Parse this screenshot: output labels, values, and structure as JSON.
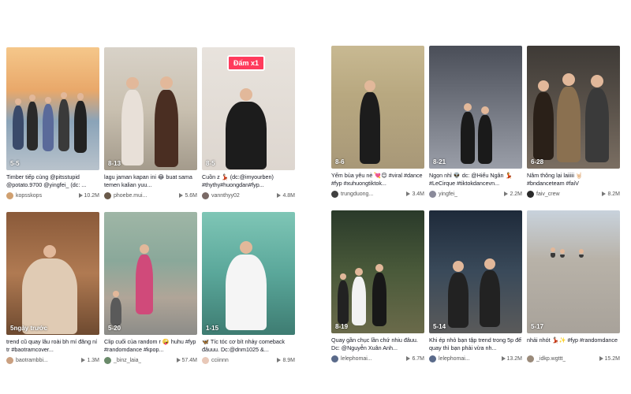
{
  "left_videos": [
    {
      "date": "5-5",
      "caption": "Timber tiếp cùng @pitsstupid @potato.9700 @yingfei_ (dc: ...",
      "author": "kopsskops",
      "views": "10.2M",
      "bg": "linear-gradient(180deg,#f5c78a 0%,#e9a86a 35%,#8aa3b8 60%,#b9c3cc 100%)",
      "avatar_color": "#d0a070"
    },
    {
      "date": "8-13",
      "caption": "lagu jaman kapan ini 😂 buat sama temen kalian yuu...",
      "author": "phoebe.mui...",
      "views": "5.6M",
      "bg": "linear-gradient(180deg,#d8d2c8 0%,#c9c0b0 50%,#a49b8c 100%)",
      "avatar_color": "#6a5a4a"
    },
    {
      "date": "8-5",
      "sticker": "Đấm x1",
      "caption": "Cuồn z 💃🏻 (dc:@imyourben) #thythy#huongdan#fyp...",
      "author": "vannthyy02",
      "views": "4.8M",
      "bg": "linear-gradient(180deg,#e8e3dd 0%,#ddd6cf 100%)",
      "avatar_color": "#7a6a66"
    },
    {
      "date": "5ngày trước",
      "caption": "trend cũ quay lâu roài bh mí đăng ní tr #baotramcover...",
      "author": "baotrambbi...",
      "views": "1.3M",
      "bg": "linear-gradient(180deg,#8a5a3a 0%,#b07a52 50%,#6e4a30 100%)",
      "avatar_color": "#caa080"
    },
    {
      "date": "5-20",
      "caption": "Clip cuối của random r 🤪 huhu #fyp #randomdance #kpop...",
      "author": "_binz_laia_",
      "views": "57.4M",
      "bg": "linear-gradient(180deg,#9fb6a6 0%,#8aa89a 40%,#b0a598 70%,#8c8c88 100%)",
      "avatar_color": "#6a8a6a"
    },
    {
      "date": "1-15",
      "caption": "🦋 Tíc tóc cơ bít nhảy comeback đâuuu. Dc:@dnm1025 &...",
      "author": "cciinnn",
      "views": "8.9M",
      "bg": "linear-gradient(180deg,#7fc6b6 0%,#5aa79a 50%,#3e7c72 100%)",
      "avatar_color": "#e8c8b8"
    }
  ],
  "right_videos": [
    {
      "date": "8-6",
      "caption": "Yếm bùa yêu nè 💘😊 #viral #dance #fyp #xuhuongtiktok...",
      "author": "trungduong...",
      "views": "3.4M",
      "bg": "linear-gradient(180deg,#c8b992 0%,#b8a880 40%,#a89878 100%)",
      "avatar_color": "#404040"
    },
    {
      "date": "8-21",
      "caption": "Ngọn nhỉ 👽 dc: @Hiếu Ngân 💃 #LeCirque #tiktokdancevn...",
      "author": "yingfei_",
      "views": "2.2M",
      "bg": "linear-gradient(180deg,#4a4e58 0%,#6a6e78 40%,#9a9ea8 100%)",
      "avatar_color": "#8a8a9a"
    },
    {
      "date": "6-28",
      "caption": "Nâm thông lại laiiiii 🤘🏻 #bndanceteam #faiV",
      "author": "faiv_crew",
      "views": "8.2M",
      "bg": "linear-gradient(180deg,#3e3a36 0%,#5a524a 50%,#7a6e62 100%)",
      "avatar_color": "#2a2a2a"
    },
    {
      "date": "8-19",
      "caption": "Quay gần chục lần chứ nhiu đâuu. Dc: @Nguyễn Xuân Anh...",
      "author": "lelephomai...",
      "views": "6.7M",
      "bg": "linear-gradient(180deg,#2a3a2a 0%,#4a5a3a 50%,#6a6a4a 100%)",
      "avatar_color": "#5a6a8a"
    },
    {
      "date": "5-14",
      "caption": "Khi ép nhỏ bạn tập trend trong 5p để quay thì bạn phải vừa nh...",
      "author": "lelephomai...",
      "views": "13.2M",
      "bg": "linear-gradient(180deg,#1e2a3a 0%,#3a4a5a 50%,#5a5a5a 100%)",
      "avatar_color": "#5a6a8a"
    },
    {
      "date": "5-17",
      "caption": "nhải nhót 💃🏻✨ #fyp #randomdance",
      "author": "_idkp.wgttt_",
      "views": "15.2M",
      "bg": "linear-gradient(180deg,#c8d2dc 0%,#b8b2a8 40%,#a8a29a 100%)",
      "avatar_color": "#9a8a7a"
    }
  ]
}
